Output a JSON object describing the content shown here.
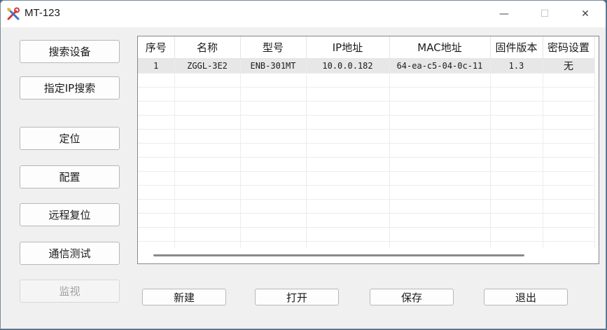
{
  "window": {
    "title": "MT-123",
    "minimize_glyph": "—",
    "maximize_glyph": "☐",
    "close_glyph": "✕"
  },
  "sidebar": {
    "buttons": [
      {
        "label": "搜索设备",
        "enabled": true
      },
      {
        "label": "指定IP搜索",
        "enabled": true
      },
      {
        "label": "定位",
        "enabled": true
      },
      {
        "label": "配置",
        "enabled": true
      },
      {
        "label": "远程复位",
        "enabled": true
      },
      {
        "label": "通信测试",
        "enabled": true
      },
      {
        "label": "监视",
        "enabled": false
      }
    ]
  },
  "device_list": {
    "columns": [
      "序号",
      "名称",
      "型号",
      "IP地址",
      "MAC地址",
      "固件版本",
      "密码设置"
    ],
    "rows": [
      {
        "index": "1",
        "name": "ZGGL-3E2",
        "model": "ENB-301MT",
        "ip": "10.0.0.182",
        "mac": "64-ea-c5-04-0c-11",
        "firmware": "1.3",
        "password": "无"
      }
    ]
  },
  "bottom_buttons": {
    "new_label": "新建",
    "open_label": "打开",
    "save_label": "保存",
    "exit_label": "退出"
  }
}
